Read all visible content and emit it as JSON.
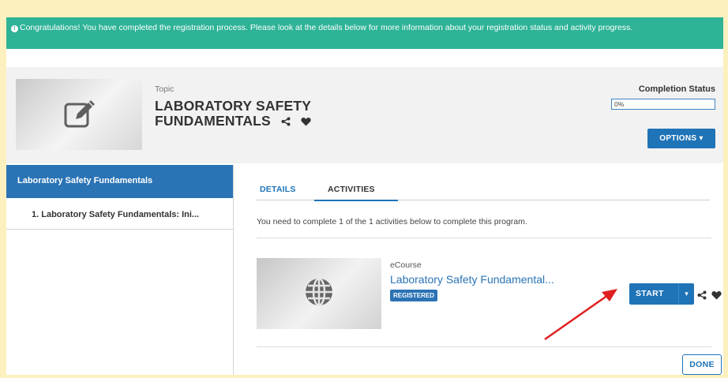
{
  "banner": {
    "message": "Congratulations! You have completed the registration process. Please look at the details below for more information about your registration status and activity progress."
  },
  "header": {
    "topic_label": "Topic",
    "title": "LABORATORY SAFETY FUNDAMENTALS",
    "completion_label": "Completion Status",
    "progress_text": "0%",
    "progress_value": 0,
    "options_label": "OPTIONS ▾"
  },
  "sidebar": {
    "items": [
      {
        "label": "Laboratory Safety Fundamentals",
        "active": true
      },
      {
        "label": "1. Laboratory Safety Fundamentals: Ini...",
        "active": false
      }
    ]
  },
  "tabs": [
    {
      "label": "DETAILS"
    },
    {
      "label": "ACTIVITIES",
      "active": true
    }
  ],
  "activities": {
    "instructions": "You need to complete 1 of the 1 activities below to complete this program.",
    "items": [
      {
        "type": "eCourse",
        "title": "Laboratory Safety Fundamental...",
        "badge": "REGISTERED",
        "start_label": "START",
        "caret": "▾"
      }
    ],
    "done_label": "DONE"
  },
  "colors": {
    "banner": "#2eb397",
    "primary": "#1f73b7",
    "annotation_arrow": "#e02020",
    "outer_frame": "#fdf0bf"
  },
  "icons": {
    "banner": "info-icon",
    "thumbnail": "edit-icon",
    "activity_thumbnail": "globe-icon",
    "share": "share-icon",
    "favorite": "heart-icon"
  }
}
